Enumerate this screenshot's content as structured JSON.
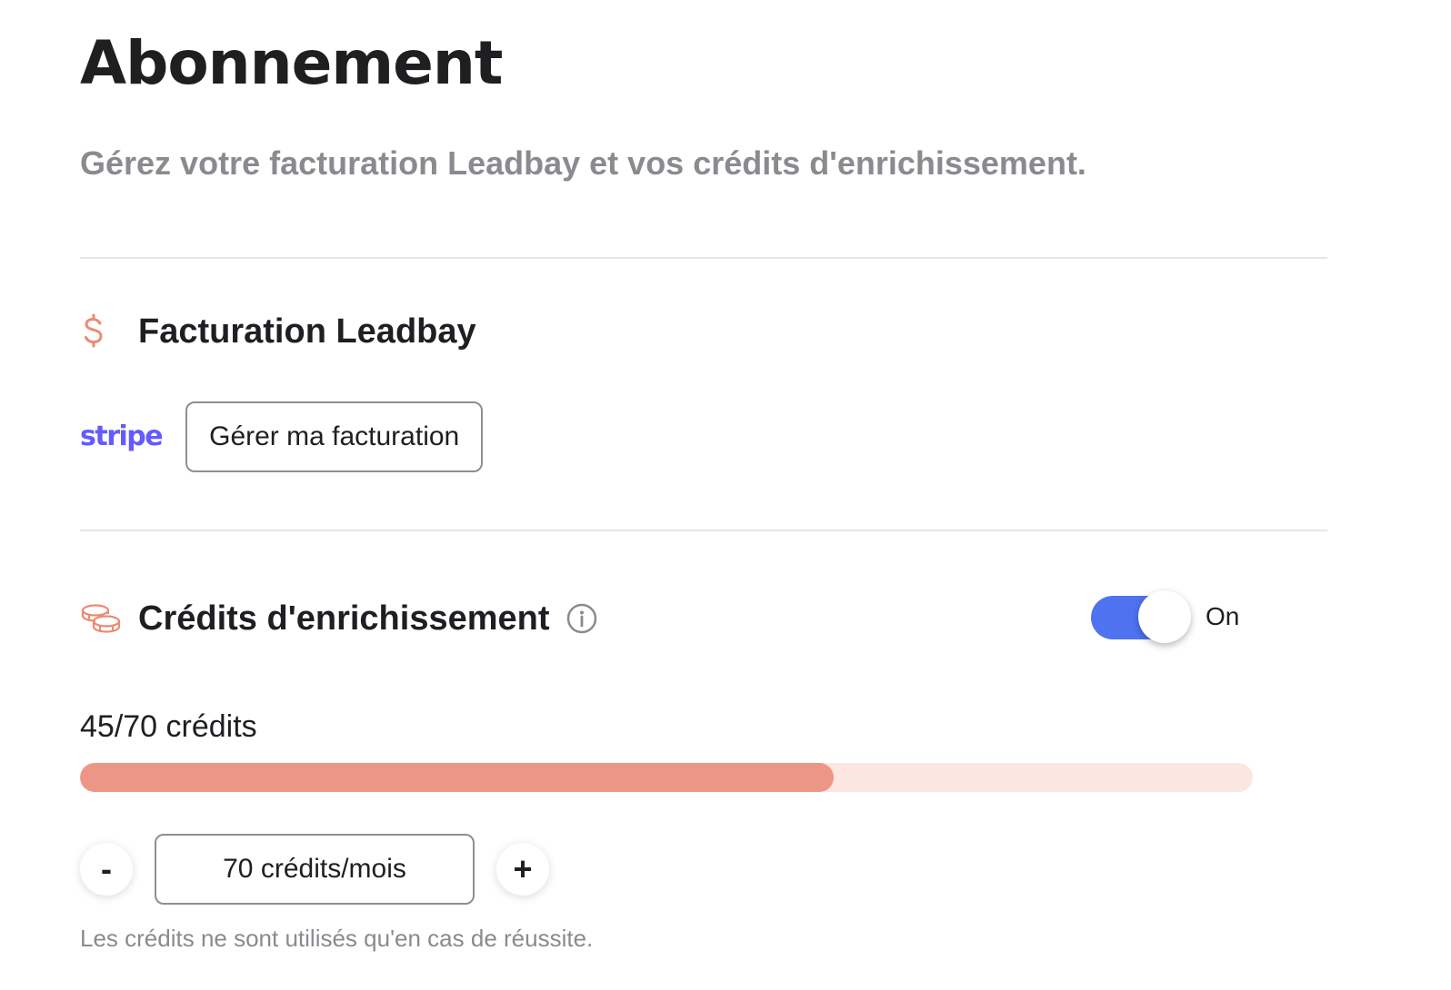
{
  "page": {
    "title": "Abonnement",
    "subtitle": "Gérez votre facturation Leadbay et vos crédits d'enrichissement."
  },
  "billing": {
    "title": "Facturation Leadbay",
    "icon": "dollar-icon",
    "provider_logo": "stripe",
    "manage_button": "Gérer ma facturation"
  },
  "credits": {
    "title": "Crédits d'enrichissement",
    "icon": "coins-icon",
    "info_icon": "info-icon",
    "toggle_label": "On",
    "toggle_on": true,
    "usage_text": "45/70 crédits",
    "used": 45,
    "total": 70,
    "decrement_label": "-",
    "increment_label": "+",
    "monthly_value": "70 crédits/mois",
    "note": "Les crédits ne sont utilisés qu'en cas de réussite."
  },
  "colors": {
    "accent": "#4f72f0",
    "stripe": "#635bff",
    "progress_fill": "#ec9785",
    "progress_track": "#fbe6e1",
    "icon": "#ec8a74"
  }
}
